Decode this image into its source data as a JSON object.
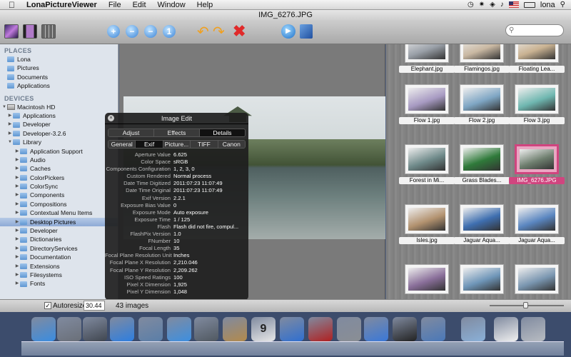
{
  "menubar": {
    "app_name": "LonaPictureViewer",
    "items": [
      "File",
      "Edit",
      "Window",
      "Help"
    ],
    "user": "lona"
  },
  "window": {
    "title": "IMG_6276.JPG"
  },
  "toolbar": {
    "search_placeholder": ""
  },
  "sidebar": {
    "places_header": "PLACES",
    "places": [
      "Lona",
      "Pictures",
      "Documents",
      "Applications"
    ],
    "devices_header": "DEVICES",
    "device": "Macintosh HD",
    "tree": [
      {
        "label": "Applications",
        "indent": 1
      },
      {
        "label": "Developer",
        "indent": 1
      },
      {
        "label": "Developer-3.2.6",
        "indent": 1
      },
      {
        "label": "Library",
        "indent": 1,
        "open": true
      },
      {
        "label": "Application Support",
        "indent": 2
      },
      {
        "label": "Audio",
        "indent": 2
      },
      {
        "label": "Caches",
        "indent": 2
      },
      {
        "label": "ColorPickers",
        "indent": 2
      },
      {
        "label": "ColorSync",
        "indent": 2
      },
      {
        "label": "Components",
        "indent": 2
      },
      {
        "label": "Compositions",
        "indent": 2
      },
      {
        "label": "Contextual Menu Items",
        "indent": 2
      },
      {
        "label": "Desktop Pictures",
        "indent": 2,
        "selected": true
      },
      {
        "label": "Developer",
        "indent": 2
      },
      {
        "label": "Dictionaries",
        "indent": 2
      },
      {
        "label": "DirectoryServices",
        "indent": 2
      },
      {
        "label": "Documentation",
        "indent": 2
      },
      {
        "label": "Extensions",
        "indent": 2
      },
      {
        "label": "Filesystems",
        "indent": 2
      },
      {
        "label": "Fonts",
        "indent": 2
      }
    ]
  },
  "browser": {
    "thumbnails": [
      {
        "name": "Elephant.jpg",
        "color": "#9aa0a8"
      },
      {
        "name": "Flamingos.jpg",
        "color": "#c9b8a2"
      },
      {
        "name": "Floating Lea...",
        "color": "#c9b292"
      },
      {
        "name": "Flow 1.jpg",
        "color": "#a79ac2"
      },
      {
        "name": "Flow 2.jpg",
        "color": "#7fa6c4"
      },
      {
        "name": "Flow 3.jpg",
        "color": "#6fb7b0"
      },
      {
        "name": "Forest in Mi...",
        "color": "#6f8a8a"
      },
      {
        "name": "Grass Blades...",
        "color": "#2f7a3a"
      },
      {
        "name": "IMG_6276.JPG",
        "color": "#6f7f6f",
        "selected": true
      },
      {
        "name": "Isles.jpg",
        "color": "#b2926f"
      },
      {
        "name": "Jaguar Aqua...",
        "color": "#3f6fb0"
      },
      {
        "name": "Jaguar Aqua...",
        "color": "#5a86c0"
      },
      {
        "name": "",
        "color": "#8a6f9a"
      },
      {
        "name": "",
        "color": "#6f96b8"
      },
      {
        "name": "",
        "color": "#7a96b0"
      }
    ]
  },
  "hud": {
    "title": "Image Edit",
    "tabs": [
      "Adjust",
      "Effects",
      "Details"
    ],
    "active_tab": "Details",
    "subtabs": [
      "General",
      "Exif",
      "Picture...",
      "TIFF",
      "Canon"
    ],
    "active_subtab": "Exif",
    "rows": [
      {
        "k": "Aperture Value",
        "v": "6.625"
      },
      {
        "k": "Color Space",
        "v": "sRGB"
      },
      {
        "k": "Components Configuration",
        "v": "1, 2, 3, 0"
      },
      {
        "k": "Custom Rendered",
        "v": "Normal process"
      },
      {
        "k": "Date Time Digitized",
        "v": "2011:07:23 11:07:49"
      },
      {
        "k": "Date Time Original",
        "v": "2011:07:23 11:07:49"
      },
      {
        "k": "Exif Version",
        "v": "2.2.1"
      },
      {
        "k": "Exposure Bias Value",
        "v": "0"
      },
      {
        "k": "Exposure Mode",
        "v": "Auto exposure"
      },
      {
        "k": "Exposure Time",
        "v": "1 / 125"
      },
      {
        "k": "Flash",
        "v": "Flash did not fire, compul..."
      },
      {
        "k": "FlashPix Version",
        "v": "1.0"
      },
      {
        "k": "FNumber",
        "v": "10"
      },
      {
        "k": "Focal Length",
        "v": "35"
      },
      {
        "k": "Focal Plane Resolution Unit",
        "v": "Inches"
      },
      {
        "k": "Focal Plane X Resolution",
        "v": "2,210.046"
      },
      {
        "k": "Focal Plane Y Resolution",
        "v": "2,209.262"
      },
      {
        "k": "ISO Speed Ratings",
        "v": "100"
      },
      {
        "k": "Pixel X Dimension",
        "v": "1,925"
      },
      {
        "k": "Pixel Y Dimension",
        "v": "1,048"
      }
    ]
  },
  "statusbar": {
    "autoresize_label": "Autoresize",
    "autoresize_checked": true,
    "zoom_value": "30.44",
    "image_count": "43 images"
  },
  "dock": {
    "apps": [
      {
        "icon": "finder-icon",
        "color": "#3a8ce0"
      },
      {
        "icon": "launchpad-icon",
        "color": "#6a6f78"
      },
      {
        "icon": "mission-control-icon",
        "color": "#40464f"
      },
      {
        "icon": "app-store-icon",
        "color": "#2d7ee0"
      },
      {
        "icon": "mail-icon",
        "color": "#5a7ea8"
      },
      {
        "icon": "safari-icon",
        "color": "#3d8fe0"
      },
      {
        "icon": "facetime-icon",
        "color": "#505860"
      },
      {
        "icon": "address-book-icon",
        "color": "#b28a4c"
      },
      {
        "icon": "ical-icon",
        "color": "#e8e8e8"
      },
      {
        "icon": "itunes-icon",
        "color": "#2f6fd0"
      },
      {
        "icon": "photo-booth-icon",
        "color": "#b02020"
      },
      {
        "icon": "system-preferences-icon",
        "color": "#8a8e94"
      },
      {
        "icon": "xcode-icon",
        "color": "#3a78d8"
      },
      {
        "icon": "terminal-icon",
        "color": "#222"
      },
      {
        "icon": "preview-icon",
        "color": "#4a78b8"
      },
      {
        "icon": "downloads-folder-icon",
        "color": "#8ab0d8"
      },
      {
        "icon": "document-icon",
        "color": "#f0f0f0"
      },
      {
        "icon": "trash-icon",
        "color": "#b8bcc2"
      }
    ],
    "ical_day": "9"
  }
}
